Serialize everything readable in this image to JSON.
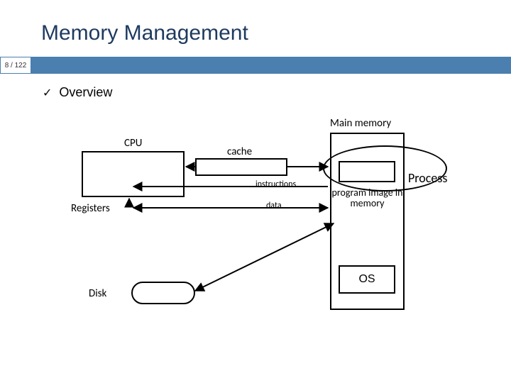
{
  "title": "Memory Management",
  "page": "8 / 122",
  "bullet": "Overview",
  "diagram": {
    "main_memory": "Main memory",
    "cpu": "CPU",
    "cache": "cache",
    "registers": "Registers",
    "instructions": "instructions",
    "data": "data",
    "process": "Process",
    "program_image": "program image in memory",
    "os": "OS",
    "disk": "Disk"
  }
}
